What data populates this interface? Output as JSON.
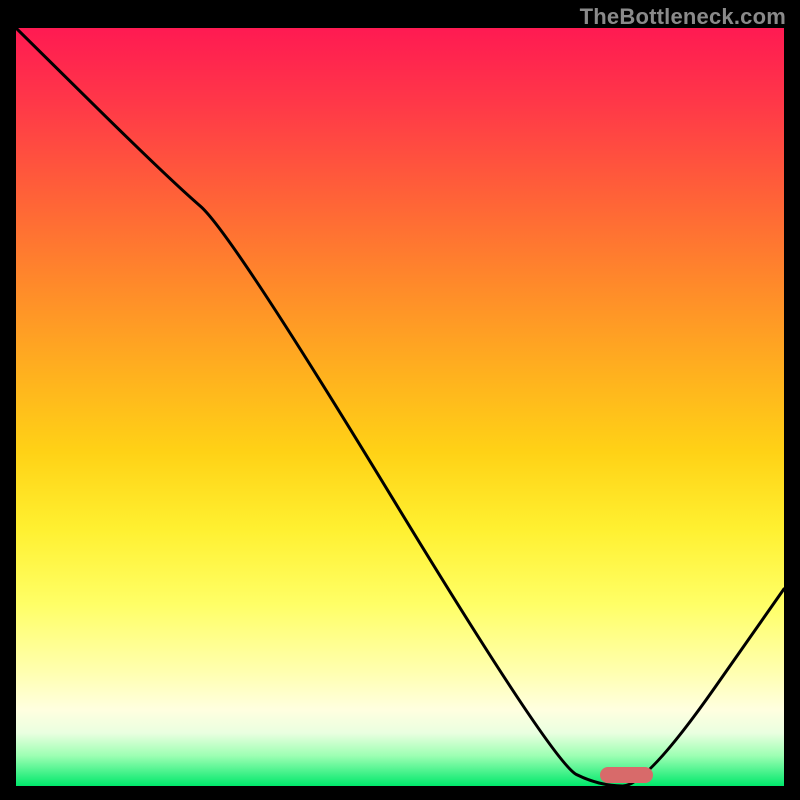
{
  "watermark": {
    "text": "TheBottleneck.com"
  },
  "chart_data": {
    "type": "line",
    "title": "",
    "xlabel": "",
    "ylabel": "",
    "xlim": [
      0,
      100
    ],
    "ylim": [
      0,
      100
    ],
    "grid": false,
    "series": [
      {
        "name": "bottleneck-curve",
        "x": [
          0,
          20,
          28,
          70,
          76,
          82,
          100
        ],
        "values": [
          100,
          80,
          73,
          3,
          0,
          0,
          26
        ]
      }
    ],
    "marker": {
      "x_start": 76,
      "x_end": 83,
      "y": 1.5,
      "color": "#d86a6a"
    },
    "gradient_stops": [
      {
        "pct": 0,
        "color": "#ff1a52"
      },
      {
        "pct": 10,
        "color": "#ff3848"
      },
      {
        "pct": 22,
        "color": "#ff6138"
      },
      {
        "pct": 34,
        "color": "#ff8a2a"
      },
      {
        "pct": 46,
        "color": "#ffb21e"
      },
      {
        "pct": 56,
        "color": "#ffd216"
      },
      {
        "pct": 66,
        "color": "#fff030"
      },
      {
        "pct": 76,
        "color": "#ffff66"
      },
      {
        "pct": 85,
        "color": "#ffffb0"
      },
      {
        "pct": 90,
        "color": "#ffffe0"
      },
      {
        "pct": 93,
        "color": "#eaffe0"
      },
      {
        "pct": 96,
        "color": "#9dffb3"
      },
      {
        "pct": 100,
        "color": "#00e86b"
      }
    ]
  }
}
